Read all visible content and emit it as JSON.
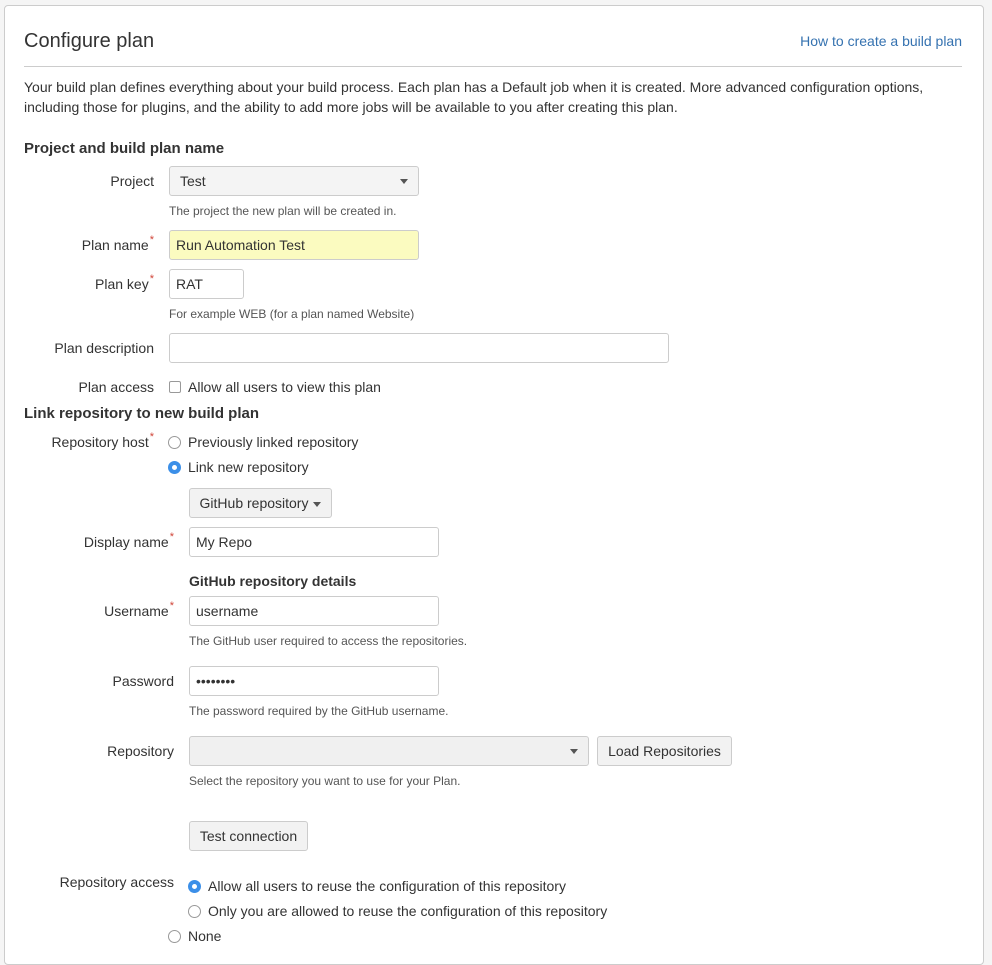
{
  "header": {
    "title": "Configure plan",
    "help_link": "How to create a build plan"
  },
  "intro": "Your build plan defines everything about your build process. Each plan has a Default job when it is created. More advanced configuration options, including those for plugins, and the ability to add more jobs will be available to you after creating this plan.",
  "section_plan": {
    "title": "Project and build plan name",
    "project": {
      "label": "Project",
      "value": "Test",
      "description": "The project the new plan will be created in."
    },
    "plan_name": {
      "label": "Plan name",
      "value": "Run Automation Test"
    },
    "plan_key": {
      "label": "Plan key",
      "value": "RAT",
      "description": "For example WEB (for a plan named Website)"
    },
    "plan_description": {
      "label": "Plan description",
      "value": ""
    },
    "plan_access": {
      "label": "Plan access",
      "option": "Allow all users to view this plan",
      "checked": false
    }
  },
  "section_repo": {
    "title": "Link repository to new build plan",
    "repository_host": {
      "label": "Repository host",
      "options": [
        "Previously linked repository",
        "Link new repository"
      ],
      "selected": "Link new repository"
    },
    "repo_type_button": "GitHub repository",
    "display_name": {
      "label": "Display name",
      "value": "My Repo"
    },
    "details_title": "GitHub repository details",
    "username": {
      "label": "Username",
      "value": "username",
      "description": "The GitHub user required to access the repositories."
    },
    "password": {
      "label": "Password",
      "value": "••••••••",
      "description": "The password required by the GitHub username."
    },
    "repository": {
      "label": "Repository",
      "value": "",
      "description": "Select the repository you want to use for your Plan.",
      "load_button": "Load Repositories"
    },
    "test_connection_button": "Test connection",
    "repository_access": {
      "label": "Repository access",
      "options": [
        "Allow all users to reuse the configuration of this repository",
        "Only you are allowed to reuse the configuration of this repository"
      ],
      "selected": "Allow all users to reuse the configuration of this repository"
    },
    "none_option": "None"
  },
  "colors": {
    "accent": "#3b8fe8",
    "link": "#3572b0",
    "required": "#d04437",
    "highlight": "#fbfbc0"
  }
}
